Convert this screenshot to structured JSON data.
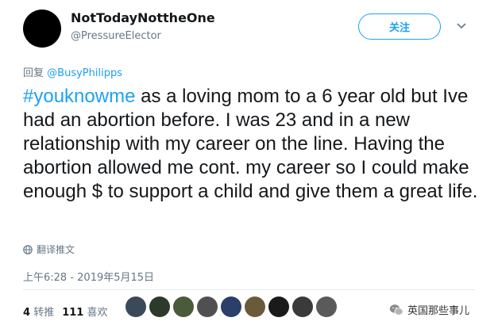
{
  "author": {
    "display_name": "NotTodayNottheOne",
    "handle": "@PressureElector"
  },
  "follow_label": "关注",
  "reply": {
    "prefix": "回复",
    "mention": "@BusyPhilipps"
  },
  "tweet": {
    "hashtag": "#youknowme",
    "body": " as a loving mom to a 6 year old but Ive had an abortion before. I was 23 and in a new relationship with my career on the line. Having the abortion allowed me cont. my career so I could make enough $ to support a child and give them a great life."
  },
  "translate_label": "翻译推文",
  "timestamp": "上午6:28 - 2019年5月15日",
  "stats": {
    "retweets_count": "4",
    "retweets_label": "转推",
    "likes_count": "111",
    "likes_label": "喜欢"
  },
  "watermark": "英国那些事儿",
  "colors": {
    "accent": "#1da1f2",
    "muted": "#657786",
    "text": "#14171a"
  }
}
